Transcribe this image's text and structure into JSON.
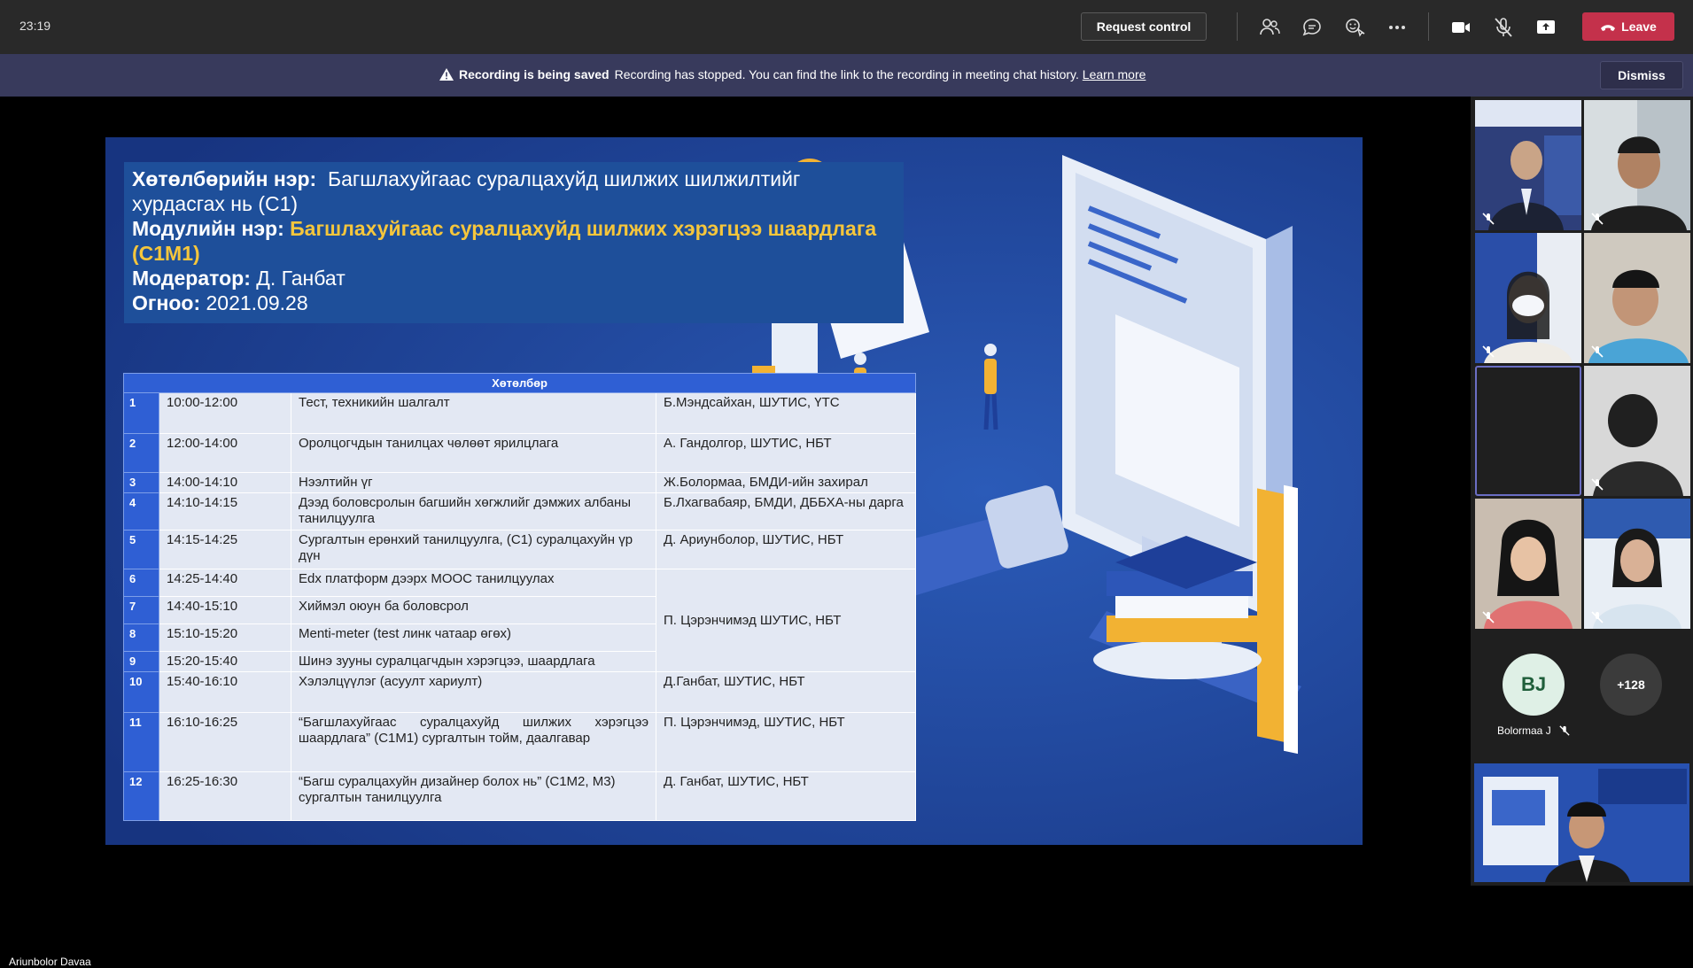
{
  "topbar": {
    "time": "23:19",
    "request_control": "Request control",
    "leave": "Leave",
    "icons": [
      "participants-icon",
      "chat-icon",
      "reactions-icon",
      "more-icon",
      "camera-icon",
      "mic-muted-icon",
      "share-icon",
      "phone-icon"
    ]
  },
  "banner": {
    "title": "Recording is being saved",
    "message": "Recording has stopped. You can find the link to the recording in meeting chat history.",
    "link": "Learn more",
    "dismiss": "Dismiss"
  },
  "slide": {
    "program_label": "Хөтөлбөрийн нэр:",
    "program_name": "Багшлахуйгаас суралцахуйд шилжих шилжилтийг хурдасгах нь (С1)",
    "module_label": "Модулийн нэр:",
    "module_name": "Багшлахуйгаас суралцахуйд шилжих хэрэгцээ шаардлага (С1М1)",
    "moderator_label": "Модератор:",
    "moderator": "Д. Ганбат",
    "date_label": "Огноо:",
    "date": "2021.09.28",
    "table_header": "Хөтөлбөр",
    "rows": [
      {
        "n": "1",
        "time": "10:00-12:00",
        "topic": "Тест, техникийн шалгалт",
        "speaker": "Б.Мэндсайхан, ШУТИС, ҮТС"
      },
      {
        "n": "2",
        "time": "12:00-14:00",
        "topic": "Оролцогчдын танилцах чөлөөт ярилцлага",
        "speaker": "А. Гандолгор, ШУТИС, НБТ"
      },
      {
        "n": "3",
        "time": "14:00-14:10",
        "topic": "Нээлтийн үг",
        "speaker": " Ж.Болормаа, БМДИ-ийн захирал"
      },
      {
        "n": "4",
        "time": "14:10-14:15",
        "topic": "Дээд боловсролын багшийн хөгжлийг дэмжих албаны танилцуулга",
        "speaker": "Б.Лхагвабаяр, БМДИ, ДББХА-ны дарга"
      },
      {
        "n": "5",
        "time": "14:15-14:25",
        "topic": "Сургалтын ерөнхий танилцуулга, (С1) суралцахуйн үр дүн",
        "speaker": "Д. Ариунболор, ШУТИС, НБТ"
      },
      {
        "n": "6",
        "time": "14:25-14:40",
        "topic": "Edx платформ дээрх МООС танилцуулах",
        "speaker": "П. Цэрэнчимэд ШУТИС, НБТ"
      },
      {
        "n": "7",
        "time": "14:40-15:10",
        "topic": "Хиймэл оюун ба боловсрол",
        "speaker": ""
      },
      {
        "n": "8",
        "time": "15:10-15:20",
        "topic": "Menti-meter (test линк чатаар өгөх)",
        "speaker": ""
      },
      {
        "n": "9",
        "time": "15:20-15:40",
        "topic": "Шинэ зууны суралцагчдын хэрэгцээ, шаардлага",
        "speaker": ""
      },
      {
        "n": "10",
        "time": "15:40-16:10",
        "topic": "Хэлэлцүүлэг (асуулт хариулт)",
        "speaker": "Д.Ганбат, ШУТИС, НБТ"
      },
      {
        "n": "11",
        "time": "16:10-16:25",
        "topic": "“Багшлахуйгаас суралцахуйд шилжих хэрэгцээ шаардлага” (С1М1) сургалтын тойм, даалгавар",
        "speaker": "П. Цэрэнчимэд, ШУТИС, НБТ"
      },
      {
        "n": "12",
        "time": "16:25-16:30",
        "topic": "“Багш суралцахуйн дизайнер болох нь” (С1М2, М3) сургалтын танилцуулга",
        "speaker": "Д. Ганбат, ШУТИС, НБТ"
      }
    ]
  },
  "presenter": "Ariunbolor Davaa",
  "rail": {
    "bj_initials": "BJ",
    "bj_name": "Bolormaa J",
    "more_count": "+128"
  }
}
